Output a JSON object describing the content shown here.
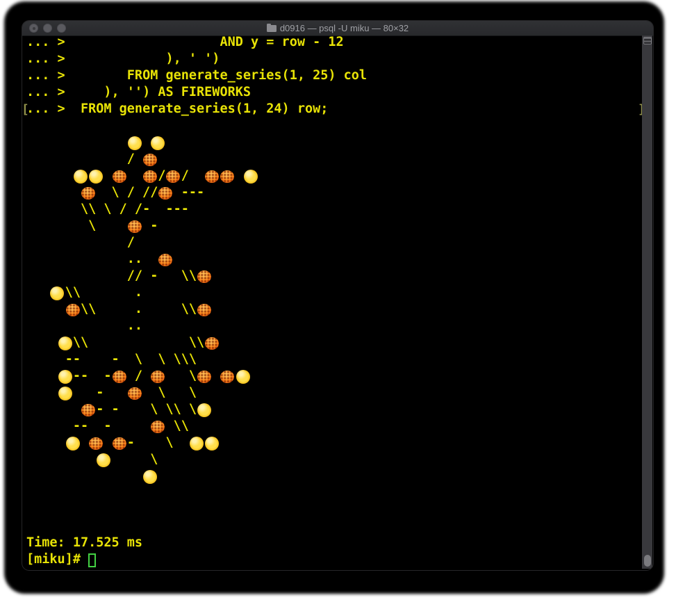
{
  "window": {
    "title": "d0916 — psql -U miku — 80×32",
    "controls": [
      "close",
      "minimize",
      "zoom"
    ]
  },
  "terminal": {
    "screen_rows": [
      "... >                    AND y = row - 12",
      "... >             ), ' ')",
      "... >        FROM generate_series(1, 25) col",
      "... >     ), '') AS FIREWORKS",
      "... >  FROM generate_series(1, 24) row;",
      "",
      "             🟡 🟡",
      "             / 🎆",
      "      🟡🟡 🎆  🎆/🎆/  🎆🎆 🟡",
      "       🎆  \\ / //🎆 ---",
      "       \\\\ \\ / /-  ---",
      "        \\    🎆 -",
      "             /",
      "             ..  🎆",
      "             // -   \\\\🎆",
      "   🟡\\\\       .",
      "     🎆\\\\     .     \\\\🎆",
      "             ..",
      "    🟡\\\\             \\\\🎆",
      "     --    -  \\  \\ \\\\\\",
      "    🟡--  -🎆 / 🎆   \\🎆 🎆🟡",
      "    🟡   -   🎆  \\   \\",
      "       🎆- -    \\ \\\\ \\🟡",
      "      --  -     🎆 \\\\",
      "     🟡 🎆 🎆-    \\  🟡🟡",
      "         🟡     \\",
      "               🟡",
      "",
      "",
      "",
      "Time: 17.525 ms",
      "[miku]# "
    ],
    "marks": {
      "left": "[",
      "right": "]",
      "row": 4
    },
    "emoji_legend": {
      "🟡": "yellow-ball-emoji",
      "🎆": "orange-firework-emoji"
    },
    "colors": {
      "background": "#000000",
      "text": "#e8e306",
      "cursor": "#43d243",
      "titlebar": "#2b2c2f",
      "title_text": "#9fa0a5"
    }
  }
}
